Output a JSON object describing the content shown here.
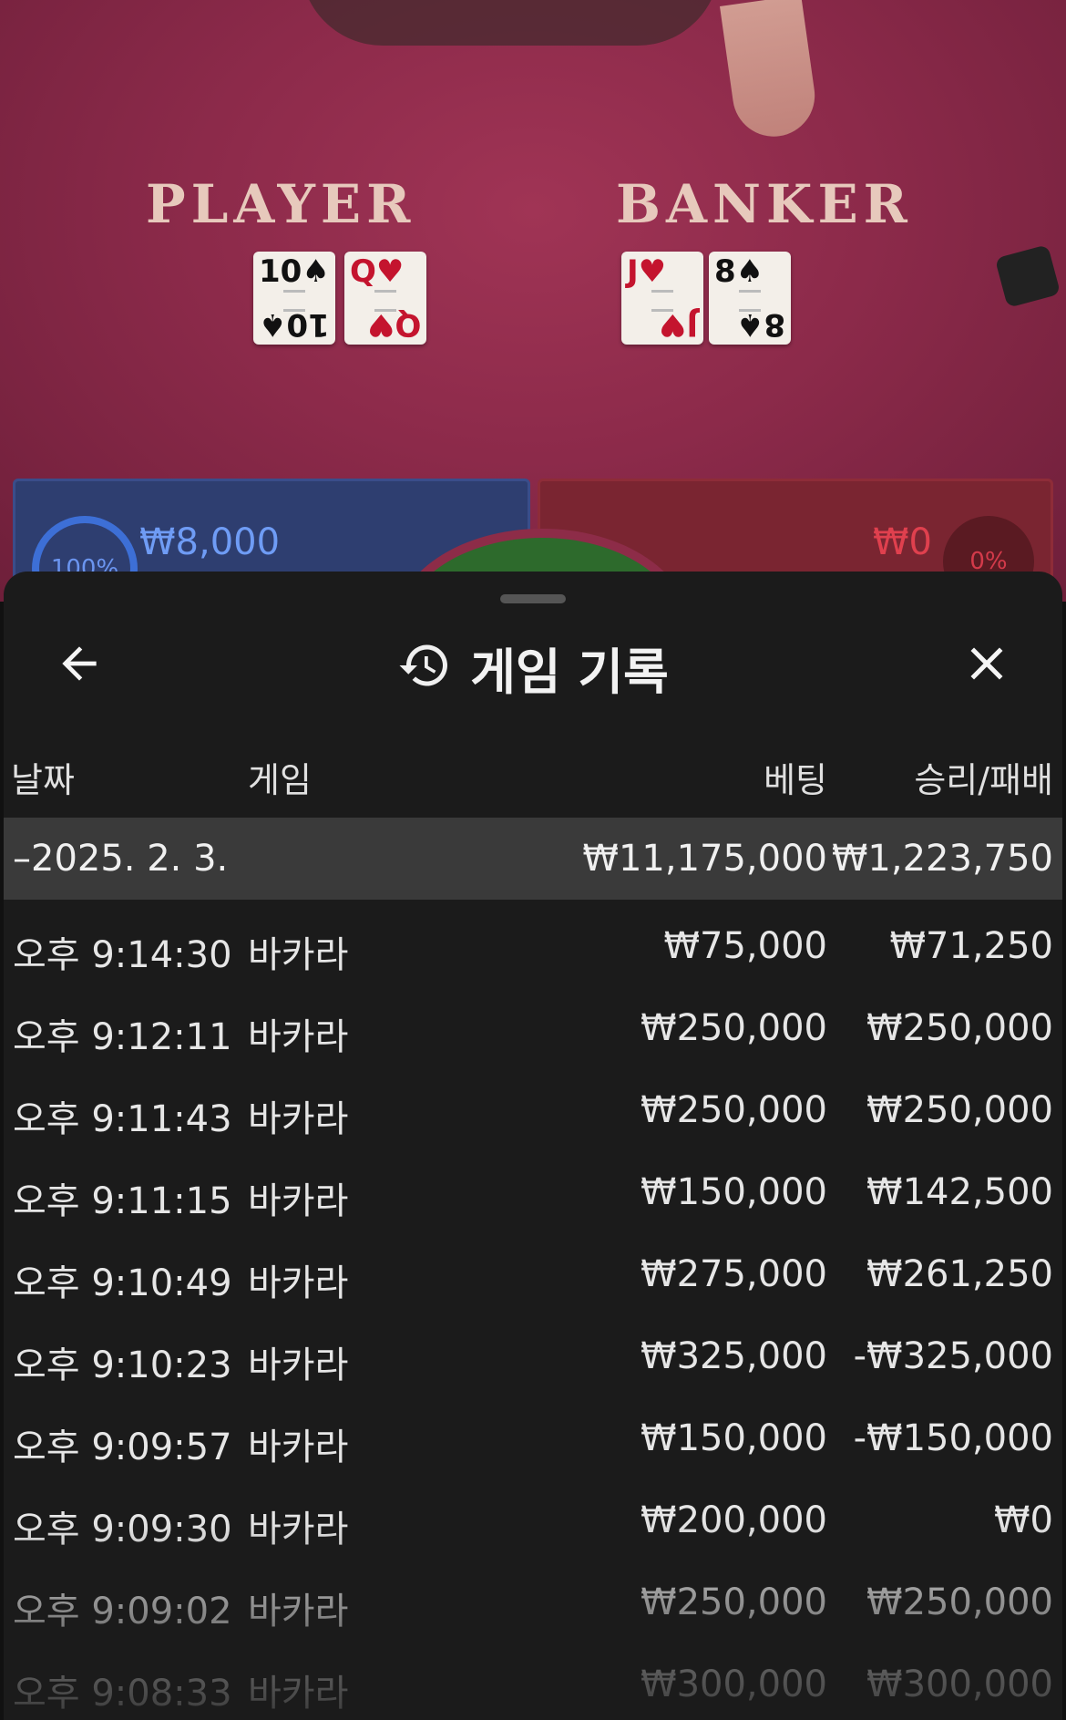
{
  "scene": {
    "player_label": "PLAYER",
    "banker_label": "BANKER",
    "player_cards": [
      {
        "rank": "10",
        "suit": "♠",
        "color": "black"
      },
      {
        "rank": "Q",
        "suit": "♥",
        "color": "red"
      }
    ],
    "banker_cards": [
      {
        "rank": "J",
        "suit": "♥",
        "color": "red"
      },
      {
        "rank": "8",
        "suit": "♠",
        "color": "black"
      }
    ],
    "player_bet": {
      "percent": "100%",
      "amount": "₩8,000"
    },
    "banker_bet": {
      "percent": "0%",
      "amount": "₩0"
    }
  },
  "sheet": {
    "title": "게임 기록",
    "icons": {
      "back": "arrow-left-icon",
      "history": "history-icon",
      "close": "close-icon"
    },
    "columns": {
      "date": "날짜",
      "game": "게임",
      "bet": "베팅",
      "win_loss": "승리/패배"
    },
    "summary": {
      "date": "–2025. 2. 3.",
      "bet": "₩11,175,000",
      "win_loss": "₩1,223,750"
    },
    "rows": [
      {
        "time": "오후 9:14:30",
        "game": "바카라",
        "bet": "₩75,000",
        "win_loss": "₩71,250"
      },
      {
        "time": "오후 9:12:11",
        "game": "바카라",
        "bet": "₩250,000",
        "win_loss": "₩250,000"
      },
      {
        "time": "오후 9:11:43",
        "game": "바카라",
        "bet": "₩250,000",
        "win_loss": "₩250,000"
      },
      {
        "time": "오후 9:11:15",
        "game": "바카라",
        "bet": "₩150,000",
        "win_loss": "₩142,500"
      },
      {
        "time": "오후 9:10:49",
        "game": "바카라",
        "bet": "₩275,000",
        "win_loss": "₩261,250"
      },
      {
        "time": "오후 9:10:23",
        "game": "바카라",
        "bet": "₩325,000",
        "win_loss": "-₩325,000"
      },
      {
        "time": "오후 9:09:57",
        "game": "바카라",
        "bet": "₩150,000",
        "win_loss": "-₩150,000"
      },
      {
        "time": "오후 9:09:30",
        "game": "바카라",
        "bet": "₩200,000",
        "win_loss": "₩0"
      },
      {
        "time": "오후 9:09:02",
        "game": "바카라",
        "bet": "₩250,000",
        "win_loss": "₩250,000"
      },
      {
        "time": "오후 9:08:33",
        "game": "바카라",
        "bet": "₩300,000",
        "win_loss": "₩300,000"
      }
    ]
  }
}
